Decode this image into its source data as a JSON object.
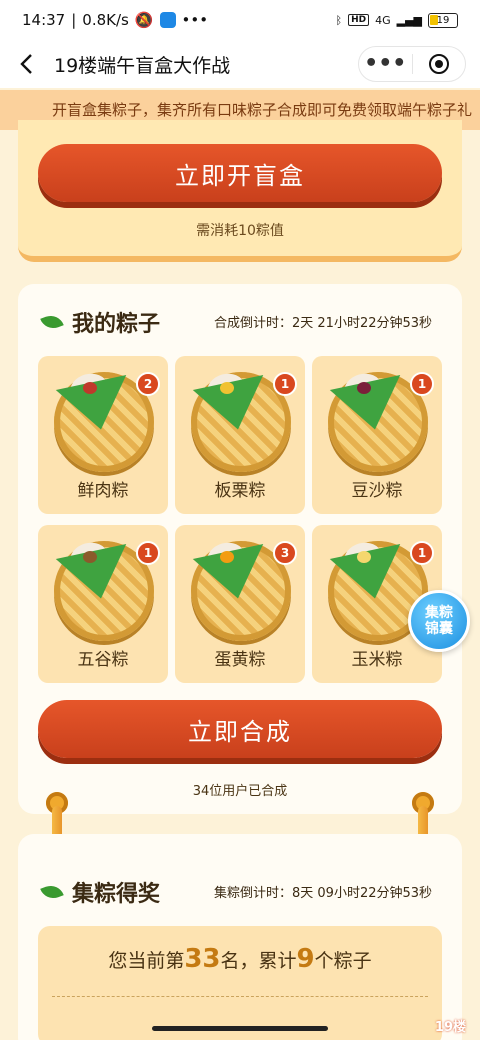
{
  "status_bar": {
    "time": "14:37",
    "speed": "0.8K/s",
    "more": "•••",
    "signal": "4G",
    "battery": "19"
  },
  "nav": {
    "title": "19楼端午盲盒大作战",
    "more_label": "•••"
  },
  "marquee": {
    "text": "开盲盒集粽子，集齐所有口味粽子合成即可免费领取端午粽子礼"
  },
  "blind_box": {
    "button_label": "立即开盲盒",
    "consume_text": "需消耗10粽值"
  },
  "my_zongzi": {
    "title": "我的粽子",
    "countdown": "合成倒计时：2天 21小时22分钟53秒",
    "items": [
      {
        "name": "鲜肉粽",
        "count": "2",
        "filling_color": "#c0392b"
      },
      {
        "name": "板栗粽",
        "count": "1",
        "filling_color": "#f1c232"
      },
      {
        "name": "豆沙粽",
        "count": "1",
        "filling_color": "#7b1f3a"
      },
      {
        "name": "五谷粽",
        "count": "1",
        "filling_color": "#8b5a2b"
      },
      {
        "name": "蛋黄粽",
        "count": "3",
        "filling_color": "#f39c12"
      },
      {
        "name": "玉米粽",
        "count": "1",
        "filling_color": "#f5d76e"
      }
    ],
    "synthesize_label": "立即合成",
    "synth_count_text": "34位用户已合成"
  },
  "float_button": {
    "label": "集粽锦囊"
  },
  "collect_award": {
    "title": "集粽得奖",
    "countdown": "集粽倒计时：8天 09小时22分钟53秒",
    "rank_prefix": "您当前第",
    "rank": "33",
    "rank_mid": "名，累计",
    "total": "9",
    "rank_suffix": "个粽子"
  },
  "watermark": "19楼",
  "colors": {
    "accent": "#d9481f",
    "background": "#fdf2d8",
    "tile": "#fde3b1",
    "leaf": "#3a9a2f"
  }
}
